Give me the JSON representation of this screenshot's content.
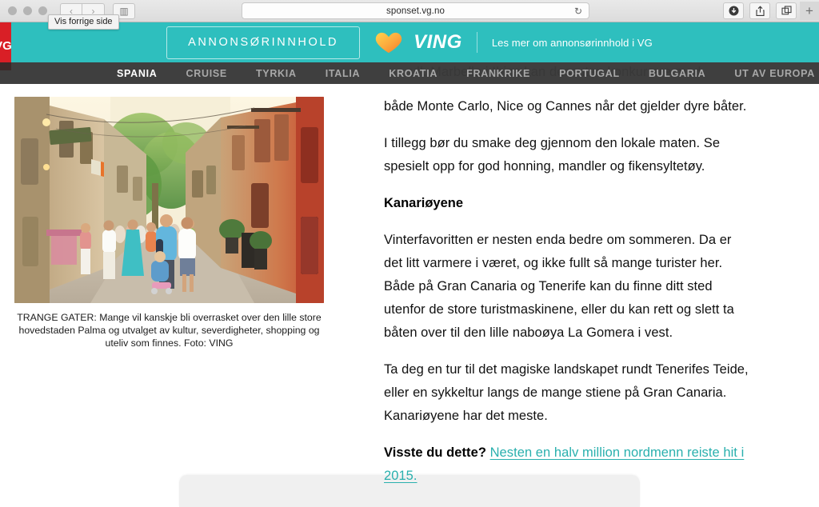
{
  "browser": {
    "url": "sponset.vg.no",
    "tooltip": "Vis forrige side",
    "back_icon": "‹",
    "forward_icon": "›",
    "sidebar_icon": "▥",
    "reload_icon": "↻",
    "download_icon": "⬇",
    "share_icon": "⇧",
    "tabs_icon": "⧉",
    "newtab_icon": "+"
  },
  "sponsor_bar": {
    "vg_flag": "VG",
    "label": "ANNONSØRINNHOLD",
    "brand": "VING",
    "heart_icon": "heart-icon",
    "more_info": "Les mer om annonsørinnhold i VG",
    "bg_color": "#2ebfbe"
  },
  "nav": {
    "items": [
      {
        "label": "SPANIA",
        "active": true
      },
      {
        "label": "CRUISE",
        "active": false
      },
      {
        "label": "TYRKIA",
        "active": false
      },
      {
        "label": "ITALIA",
        "active": false
      },
      {
        "label": "KROATIA",
        "active": false
      },
      {
        "label": "FRANKRIKE",
        "active": false
      },
      {
        "label": "PORTUGAL",
        "active": false
      },
      {
        "label": "BULGARIA",
        "active": false
      },
      {
        "label": "UT AV EUROPA",
        "active": false
      }
    ]
  },
  "article": {
    "ghost_text_behind_nav": "ull. Marbella i Ibiza kan dessuten konkurrere med",
    "photo_alt": "street-photo-palma",
    "caption": "TRANGE GATER: Mange vil kanskje bli overrasket over den lille store hovedstaden Palma og utvalget av kultur, severdigheter, shopping og uteliv som finnes. Foto: VING",
    "paragraphs": [
      "både Monte Carlo, Nice og Cannes når det gjelder dyre båter.",
      "I tillegg bør du smake deg gjennom den lokale maten. Se spesielt opp for god honning, mandler og fikensyltetøy."
    ],
    "heading": "Kanariøyene",
    "paragraphs2": [
      "Vinterfavoritten er nesten enda bedre om sommeren. Da er det litt varmere i været, og ikke fullt så mange turister her. Både på Gran Canaria og Tenerife kan du finne ditt sted utenfor de store turistmaskinene, eller du kan rett og slett ta båten over til den lille naboøya La Gomera i vest.",
      "Ta deg en tur til det magiske landskapet rundt Tenerifes Teide, eller en sykkeltur langs de mange stiene på Gran Canaria. Kanariøyene har det meste."
    ],
    "didyouknow_label": "Visste du dette?",
    "didyouknow_link": "Nesten en halv million nordmenn reiste hit i 2015.",
    "link_color": "#2ab0ae"
  }
}
